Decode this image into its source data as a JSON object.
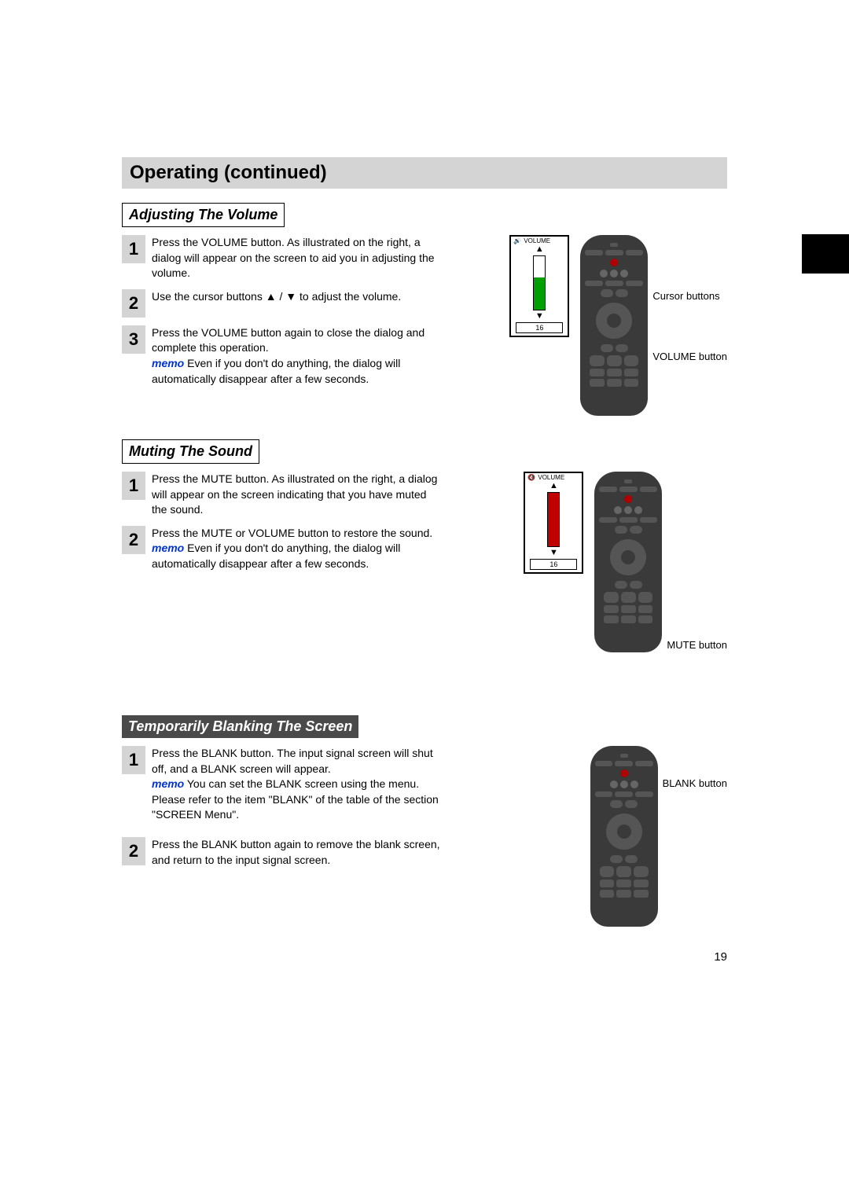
{
  "header": {
    "title": "Operating (continued)"
  },
  "section_volume": {
    "title": "Adjusting The Volume",
    "steps": [
      {
        "num": "1",
        "text": "Press the VOLUME button.\nAs illustrated on the right, a dialog will appear on the screen to aid you in adjusting the volume."
      },
      {
        "num": "2",
        "text_pre": "Use the cursor buttons ",
        "text_post": " to adjust the volume.",
        "arrows": "▲ / ▼"
      },
      {
        "num": "3",
        "text": "Press the VOLUME button again to close the dialog and complete this operation.",
        "memo": "memo",
        "memo_text": " Even if you don't do anything, the dialog will automatically disappear after a few seconds."
      }
    ],
    "dialog": {
      "label": "VOLUME",
      "value": "16",
      "up": "▲",
      "down": "▼"
    },
    "remote_labels": {
      "cursor": "Cursor buttons",
      "volume": "VOLUME button"
    }
  },
  "section_mute": {
    "title": "Muting The Sound",
    "steps": [
      {
        "num": "1",
        "text": "Press the MUTE button.\nAs illustrated on the right, a dialog will appear on the screen indicating that you have muted the sound."
      },
      {
        "num": "2",
        "text": "Press the MUTE or VOLUME button to restore the sound.",
        "memo": "memo",
        "memo_text": " Even if you don't do anything, the dialog will automatically disappear after a few seconds."
      }
    ],
    "dialog": {
      "label": "VOLUME",
      "value": "16",
      "up": "▲",
      "down": "▼"
    },
    "remote_labels": {
      "mute": "MUTE button"
    }
  },
  "section_blank": {
    "title": "Temporarily Blanking The Screen",
    "steps": [
      {
        "num": "1",
        "text": "Press the BLANK button.\nThe input signal screen will shut off, and a BLANK screen will appear.",
        "memo": "memo",
        "memo_text": " You can set the BLANK screen using the menu. Please refer to the item \"BLANK\" of the table of the section \"SCREEN Menu\"."
      },
      {
        "num": "2",
        "text": "Press the BLANK button again to remove the blank screen, and return to the input signal screen."
      }
    ],
    "remote_labels": {
      "blank": "BLANK button"
    }
  },
  "page_number": "19"
}
